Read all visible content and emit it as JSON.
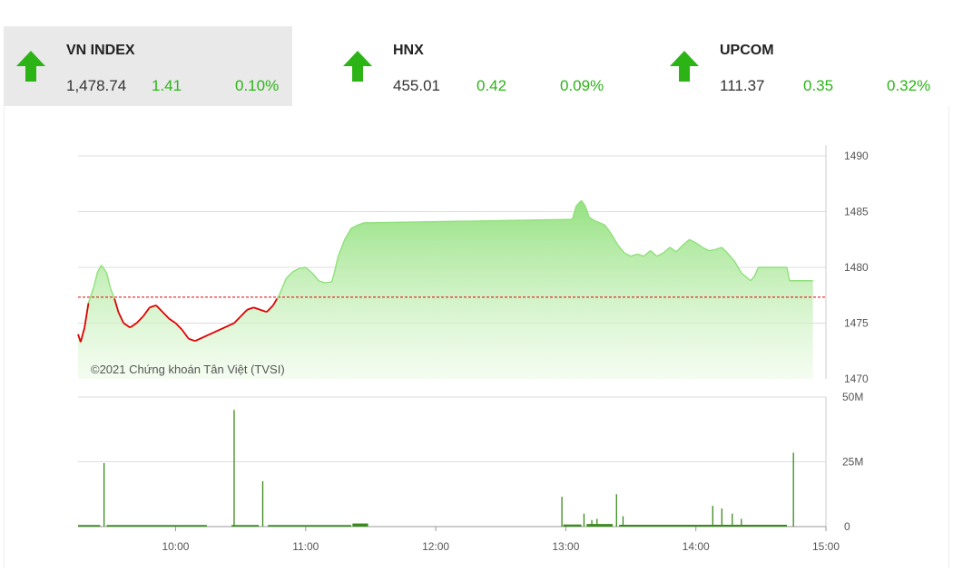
{
  "tickers": [
    {
      "name": "VN INDEX",
      "price": "1,478.74",
      "change": "1.41",
      "percent": "0.10%",
      "direction": "up",
      "active": true
    },
    {
      "name": "HNX",
      "price": "455.01",
      "change": "0.42",
      "percent": "0.09%",
      "direction": "up",
      "active": false
    },
    {
      "name": "UPCOM",
      "price": "111.37",
      "change": "0.35",
      "percent": "0.32%",
      "direction": "up",
      "active": false
    }
  ],
  "colors": {
    "up": "#2cb417",
    "down": "#e00000",
    "reference": "#e00000",
    "volume": "#3a8a1c",
    "area_top": "#8fe07a",
    "area_bottom": "#eefbe8",
    "grid": "#dddddd"
  },
  "watermark": "©2021 Chứng khoán Tân Việt (TVSI)",
  "chart_data": [
    {
      "type": "line",
      "x_unit": "time of day (hours)",
      "xlim": [
        9.25,
        15.0
      ],
      "ylim": [
        1470,
        1490
      ],
      "y_ticks": [
        "1490",
        "1485",
        "1480",
        "1475",
        "1470"
      ],
      "x_ticks": [
        "10:00",
        "11:00",
        "12:00",
        "13:00",
        "14:00",
        "15:00"
      ],
      "reference": 1477.33,
      "grid": true,
      "points": [
        [
          9.25,
          1474.0
        ],
        [
          9.27,
          1473.3
        ],
        [
          9.3,
          1474.6
        ],
        [
          9.33,
          1476.8
        ],
        [
          9.37,
          1478.2
        ],
        [
          9.4,
          1479.6
        ],
        [
          9.43,
          1480.2
        ],
        [
          9.47,
          1479.5
        ],
        [
          9.5,
          1478.1
        ],
        [
          9.53,
          1477.2
        ],
        [
          9.56,
          1476.0
        ],
        [
          9.6,
          1475.0
        ],
        [
          9.65,
          1474.6
        ],
        [
          9.7,
          1475.0
        ],
        [
          9.75,
          1475.6
        ],
        [
          9.8,
          1476.4
        ],
        [
          9.85,
          1476.6
        ],
        [
          9.9,
          1476.0
        ],
        [
          9.95,
          1475.4
        ],
        [
          10.0,
          1475.0
        ],
        [
          10.05,
          1474.4
        ],
        [
          10.1,
          1473.6
        ],
        [
          10.15,
          1473.4
        ],
        [
          10.45,
          1475.0
        ],
        [
          10.5,
          1475.6
        ],
        [
          10.55,
          1476.2
        ],
        [
          10.6,
          1476.4
        ],
        [
          10.65,
          1476.2
        ],
        [
          10.7,
          1476.0
        ],
        [
          10.75,
          1476.6
        ],
        [
          10.78,
          1477.2
        ],
        [
          10.8,
          1477.6
        ],
        [
          10.85,
          1479.0
        ],
        [
          10.9,
          1479.6
        ],
        [
          10.95,
          1479.9
        ],
        [
          11.0,
          1480.0
        ],
        [
          11.05,
          1479.5
        ],
        [
          11.1,
          1478.8
        ],
        [
          11.15,
          1478.6
        ],
        [
          11.2,
          1478.7
        ],
        [
          11.22,
          1479.5
        ],
        [
          11.25,
          1481.0
        ],
        [
          11.3,
          1482.5
        ],
        [
          11.35,
          1483.5
        ],
        [
          11.4,
          1483.8
        ],
        [
          11.45,
          1484.0
        ],
        [
          11.5,
          1484.0
        ],
        [
          13.05,
          1484.3
        ],
        [
          13.08,
          1485.5
        ],
        [
          13.12,
          1486.0
        ],
        [
          13.15,
          1485.5
        ],
        [
          13.18,
          1484.5
        ],
        [
          13.22,
          1484.2
        ],
        [
          13.26,
          1484.0
        ],
        [
          13.3,
          1483.8
        ],
        [
          13.35,
          1483.0
        ],
        [
          13.4,
          1482.0
        ],
        [
          13.45,
          1481.3
        ],
        [
          13.5,
          1481.0
        ],
        [
          13.55,
          1481.2
        ],
        [
          13.6,
          1481.0
        ],
        [
          13.65,
          1481.5
        ],
        [
          13.7,
          1481.0
        ],
        [
          13.75,
          1481.3
        ],
        [
          13.8,
          1481.8
        ],
        [
          13.85,
          1481.4
        ],
        [
          13.9,
          1482.0
        ],
        [
          13.95,
          1482.5
        ],
        [
          14.0,
          1482.2
        ],
        [
          14.05,
          1481.8
        ],
        [
          14.1,
          1481.5
        ],
        [
          14.15,
          1481.6
        ],
        [
          14.2,
          1481.8
        ],
        [
          14.25,
          1481.2
        ],
        [
          14.3,
          1480.5
        ],
        [
          14.35,
          1479.5
        ],
        [
          14.4,
          1479.0
        ],
        [
          14.42,
          1478.8
        ],
        [
          14.45,
          1479.2
        ],
        [
          14.48,
          1480.0
        ],
        [
          14.7,
          1480.0
        ],
        [
          14.72,
          1478.8
        ],
        [
          14.9,
          1478.8
        ]
      ]
    },
    {
      "type": "bar",
      "x_unit": "time of day (hours)",
      "xlim": [
        9.25,
        15.0
      ],
      "ylim": [
        0,
        50
      ],
      "y_unit": "M",
      "y_ticks": [
        "50M",
        "25M",
        "0"
      ],
      "spikes": [
        [
          9.45,
          24.5
        ],
        [
          10.45,
          45
        ],
        [
          10.67,
          17.5
        ],
        [
          12.97,
          11.5
        ],
        [
          13.14,
          5
        ],
        [
          13.2,
          2.5
        ],
        [
          13.24,
          3
        ],
        [
          13.39,
          12.5
        ],
        [
          13.44,
          4
        ],
        [
          14.13,
          8
        ],
        [
          14.2,
          7
        ],
        [
          14.28,
          5
        ],
        [
          14.35,
          3
        ],
        [
          14.75,
          28.5
        ]
      ],
      "activity": [
        [
          9.25,
          9.42,
          0.6
        ],
        [
          9.47,
          10.24,
          0.6
        ],
        [
          10.43,
          10.64,
          0.6
        ],
        [
          10.71,
          11.35,
          0.6
        ],
        [
          11.36,
          11.48,
          1.2
        ],
        [
          12.98,
          13.12,
          0.8
        ],
        [
          13.16,
          13.36,
          1.0
        ],
        [
          13.41,
          14.7,
          0.7
        ]
      ]
    }
  ]
}
